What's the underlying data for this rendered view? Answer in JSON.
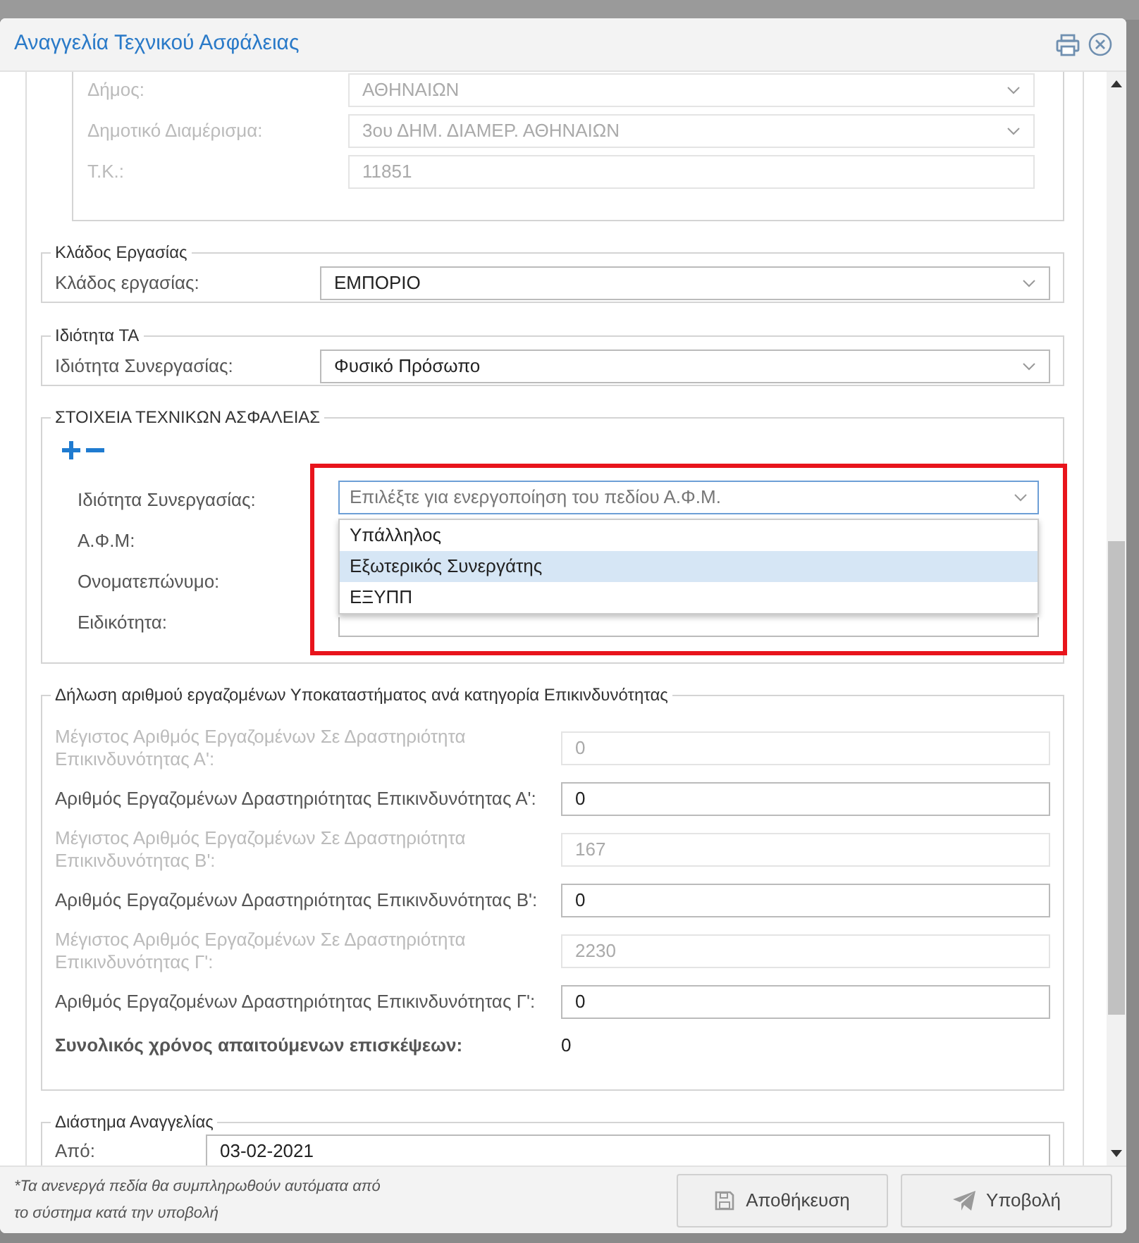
{
  "window": {
    "title": "Αναγγελία Τεχνικού Ασφάλειας"
  },
  "address_fields": [
    {
      "label": "Δήμος:",
      "value": "ΑΘΗΝΑΙΩΝ",
      "kind": "select",
      "disabled": true
    },
    {
      "label": "Δημοτικό Διαμέρισμα:",
      "value": "3ου ΔΗΜ. ΔΙΑΜΕΡ. ΑΘΗΝΑΙΩΝ",
      "kind": "select",
      "disabled": true
    },
    {
      "label": "Τ.Κ.:",
      "value": "11851",
      "kind": "input",
      "disabled": true
    }
  ],
  "sections": [
    {
      "legend": "Κλάδος Εργασίας",
      "fields": [
        {
          "label": "Κλάδος εργασίας:",
          "value": "ΕΜΠΟΡΙΟ",
          "kind": "select",
          "disabled": false
        }
      ]
    },
    {
      "legend": "Ιδιότητα ΤΑ",
      "fields": [
        {
          "label": "Ιδιότητα Συνεργασίας:",
          "value": "Φυσικό Πρόσωπο",
          "kind": "select",
          "disabled": false
        }
      ]
    }
  ],
  "technicians": {
    "legend": "ΣΤΟΙΧΕΙΑ ΤΕΧΝΙΚΩΝ ΑΣΦΑΛΕΙΑΣ",
    "select": {
      "label": "Ιδιότητα Συνεργασίας:",
      "placeholder": "Επιλέξτε για ενεργοποίηση του πεδίου Α.Φ.Μ.",
      "expanded": true,
      "options": [
        {
          "label": "Υπάλληλος",
          "selected": false
        },
        {
          "label": "Εξωτερικός Συνεργάτης",
          "selected": true
        },
        {
          "label": "ΕΞΥΠΠ",
          "selected": false
        }
      ]
    },
    "fields": [
      {
        "label": "Α.Φ.Μ:"
      },
      {
        "label": "Ονοματεπώνυμο:"
      },
      {
        "label": "Ειδικότητα:"
      }
    ]
  },
  "employees": {
    "legend": "Δήλωση αριθμού εργαζομένων Υποκαταστήματος ανά κατηγορία Επικινδυνότητας",
    "fields": [
      {
        "label": "Μέγιστος Αριθμός Εργαζομένων Σε Δραστηριότητα Επικινδυνότητας Α':",
        "value": "0",
        "disabled": true
      },
      {
        "label": "Αριθμός Εργαζομένων Δραστηριότητας Επικινδυνότητας Α':",
        "value": "0",
        "disabled": false
      },
      {
        "label": "Μέγιστος Αριθμός Εργαζομένων Σε Δραστηριότητα Επικινδυνότητας Β':",
        "value": "167",
        "disabled": true
      },
      {
        "label": "Αριθμός Εργαζομένων Δραστηριότητας Επικινδυνότητας Β':",
        "value": "0",
        "disabled": false
      },
      {
        "label": "Μέγιστος Αριθμός Εργαζομένων Σε Δραστηριότητα Επικινδυνότητας Γ':",
        "value": "2230",
        "disabled": true
      },
      {
        "label": "Αριθμός Εργαζομένων Δραστηριότητας Επικινδυνότητας Γ':",
        "value": "0",
        "disabled": false
      }
    ],
    "total": {
      "label": "Συνολικός χρόνος απαιτούμενων επισκέψεων:",
      "value": "0"
    }
  },
  "period": {
    "legend": "Διάστημα Αναγγελίας",
    "fields": [
      {
        "label": "Από:",
        "value": "03-02-2021"
      }
    ]
  },
  "footer": {
    "note": "*Τα ανενεργά πεδία θα συμπληρωθούν αυτόματα από το σύστημα κατά την υποβολή",
    "buttons": [
      {
        "label": "Αποθήκευση",
        "kind": "save"
      },
      {
        "label": "Υποβολή",
        "kind": "submit"
      }
    ]
  }
}
